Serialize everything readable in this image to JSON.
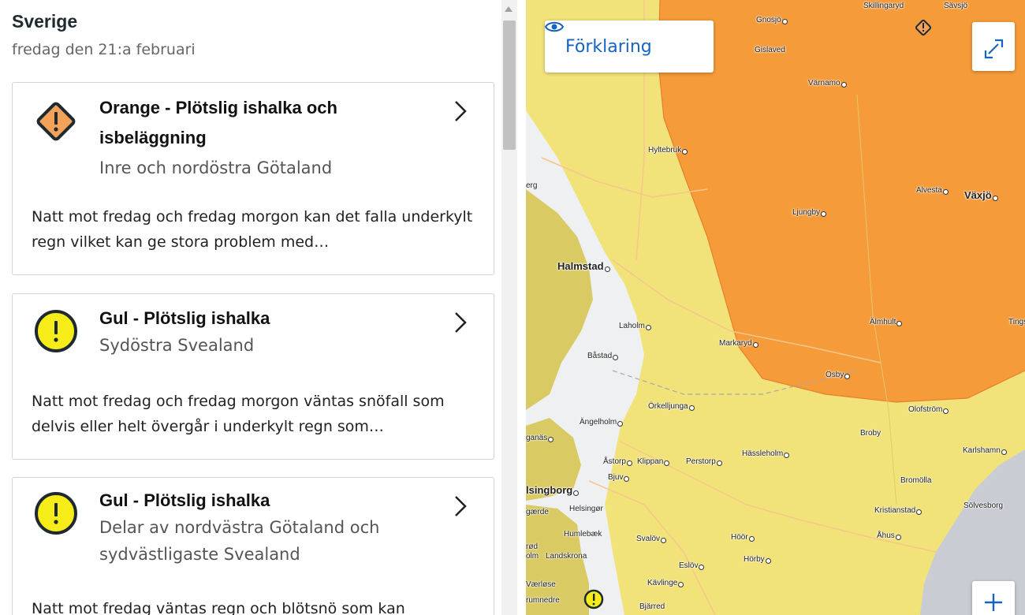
{
  "header": {
    "title": "Sverige",
    "date": "fredag den 21:a februari"
  },
  "warnings": [
    {
      "level": "orange",
      "color": "#f4a259",
      "title": "Orange - Plötslig ishalka och isbeläggning",
      "area": "Inre och nordöstra Götaland",
      "description": "Natt mot fredag och fredag morgon kan det falla underkylt regn vilket kan ge stora problem med…",
      "icon": "warning-diamond-icon"
    },
    {
      "level": "yellow",
      "color": "#f5ec1a",
      "title": "Gul - Plötslig ishalka",
      "area": "Sydöstra Svealand",
      "description": "Natt mot fredag och fredag morgon väntas snöfall som delvis eller helt övergår i underkylt regn som…",
      "icon": "warning-circle-icon"
    },
    {
      "level": "yellow",
      "color": "#f5ec1a",
      "title": "Gul - Plötslig ishalka",
      "area": "Delar av nordvästra Götaland och sydvästligaste Svealand",
      "description": "Natt mot fredag väntas regn och blötsnö som kan",
      "icon": "warning-circle-icon"
    }
  ],
  "map": {
    "legend_label": "Förklaring",
    "colors": {
      "orange_area": "#f59b3a",
      "yellow_area": "#f2e27a",
      "land_green": "#d9ca63",
      "water": "#c9cdd3",
      "coast": "#eef0f2"
    },
    "places": {
      "skillingaryd": "Skillingaryd",
      "savsjo": "Sävsjö",
      "gnosjo": "Gnosjö",
      "gislaved": "Gislaved",
      "varnamo": "Värnamo",
      "hyltebruk": "Hyltebruk",
      "alvesta": "Alvesta",
      "vaxjo": "Växjö",
      "ljungby": "Ljungby",
      "berg": "erg",
      "halmstad": "Halmstad",
      "laholm": "Laholm",
      "almhult": "Älmhult",
      "tings": "Tings",
      "markaryd": "Markaryd",
      "bastad": "Båstad",
      "osby": "Osby",
      "orkelljunga": "Örkelljunga",
      "angelholm": "Ängelholm",
      "olofstrom": "Olofström",
      "broby": "Broby",
      "ganas": "ganäs",
      "astorp": "Åstorp",
      "klippan": "Klippan",
      "perstorp": "Perstorp",
      "hassleholm": "Hässleholm",
      "karlshamn": "Karlshamn",
      "bjuv": "Bjuv",
      "bromolla": "Bromölla",
      "helsingborg": "lsingborg",
      "helsingor": "Helsingør",
      "gaerde": "gærde",
      "kristianstad": "Kristianstad",
      "solvesborg": "Sölvesborg",
      "humlebaek": "Humlebæk",
      "svalov": "Svalöv",
      "hoor": "Höör",
      "ahus": "Åhus",
      "rod": "rød",
      "olm": "olm",
      "landskrona": "Landskrona",
      "horby": "Hörby",
      "eslov": "Eslöv",
      "vaerlose": "Værløse",
      "kavlinge": "Kävlinge",
      "rumnedre": "rumnedre",
      "bjarred": "Bjärred"
    }
  }
}
